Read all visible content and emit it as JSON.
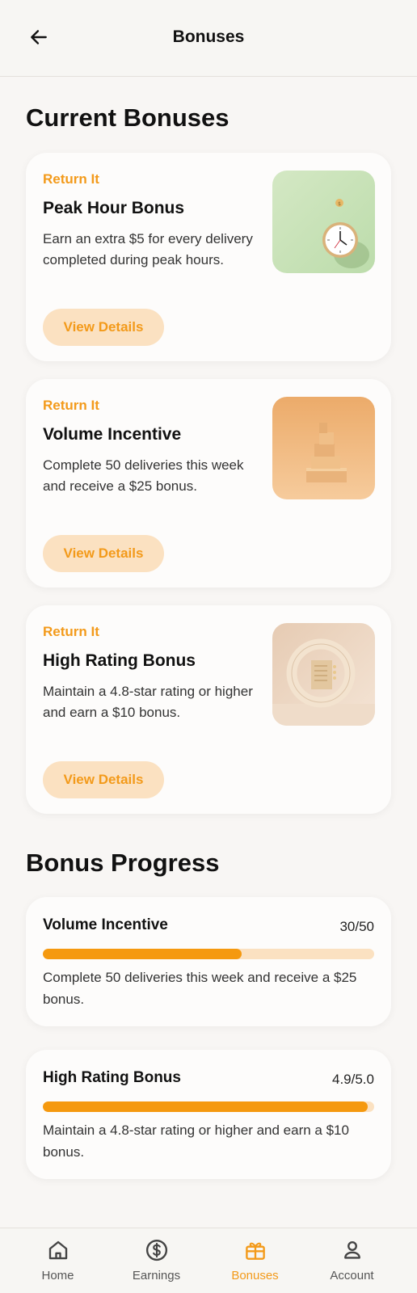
{
  "header": {
    "title": "Bonuses"
  },
  "current_section": {
    "title": "Current Bonuses"
  },
  "bonuses": [
    {
      "brand": "Return It",
      "title": "Peak Hour Bonus",
      "description": "Earn an extra $5 for every delivery completed during peak hours.",
      "button_label": "View Details",
      "image": "clock-image"
    },
    {
      "brand": "Return It",
      "title": "Volume Incentive",
      "description": "Complete 50 deliveries this week and receive a $25 bonus.",
      "button_label": "View Details",
      "image": "stacked-boxes-image"
    },
    {
      "brand": "Return It",
      "title": "High Rating Bonus",
      "description": "Maintain a 4.8-star rating or higher and earn a $10 bonus.",
      "button_label": "View Details",
      "image": "ring-frame-image"
    }
  ],
  "progress_section": {
    "title": "Bonus Progress"
  },
  "progress": [
    {
      "title": "Volume Incentive",
      "value_text": "30/50",
      "fraction": 0.6,
      "description": "Complete 50 deliveries this week and receive a $25 bonus."
    },
    {
      "title": "High Rating Bonus",
      "value_text": "4.9/5.0",
      "fraction": 0.98,
      "description": "Maintain a 4.8-star rating or higher and earn a $10 bonus."
    }
  ],
  "nav": [
    {
      "label": "Home",
      "icon": "home-icon",
      "active": false
    },
    {
      "label": "Earnings",
      "icon": "dollar-icon",
      "active": false
    },
    {
      "label": "Bonuses",
      "icon": "gift-icon",
      "active": true
    },
    {
      "label": "Account",
      "icon": "person-icon",
      "active": false
    }
  ],
  "colors": {
    "accent": "#f39a1a",
    "accent_light": "#fbe1c1",
    "background": "#f8f6f4"
  }
}
